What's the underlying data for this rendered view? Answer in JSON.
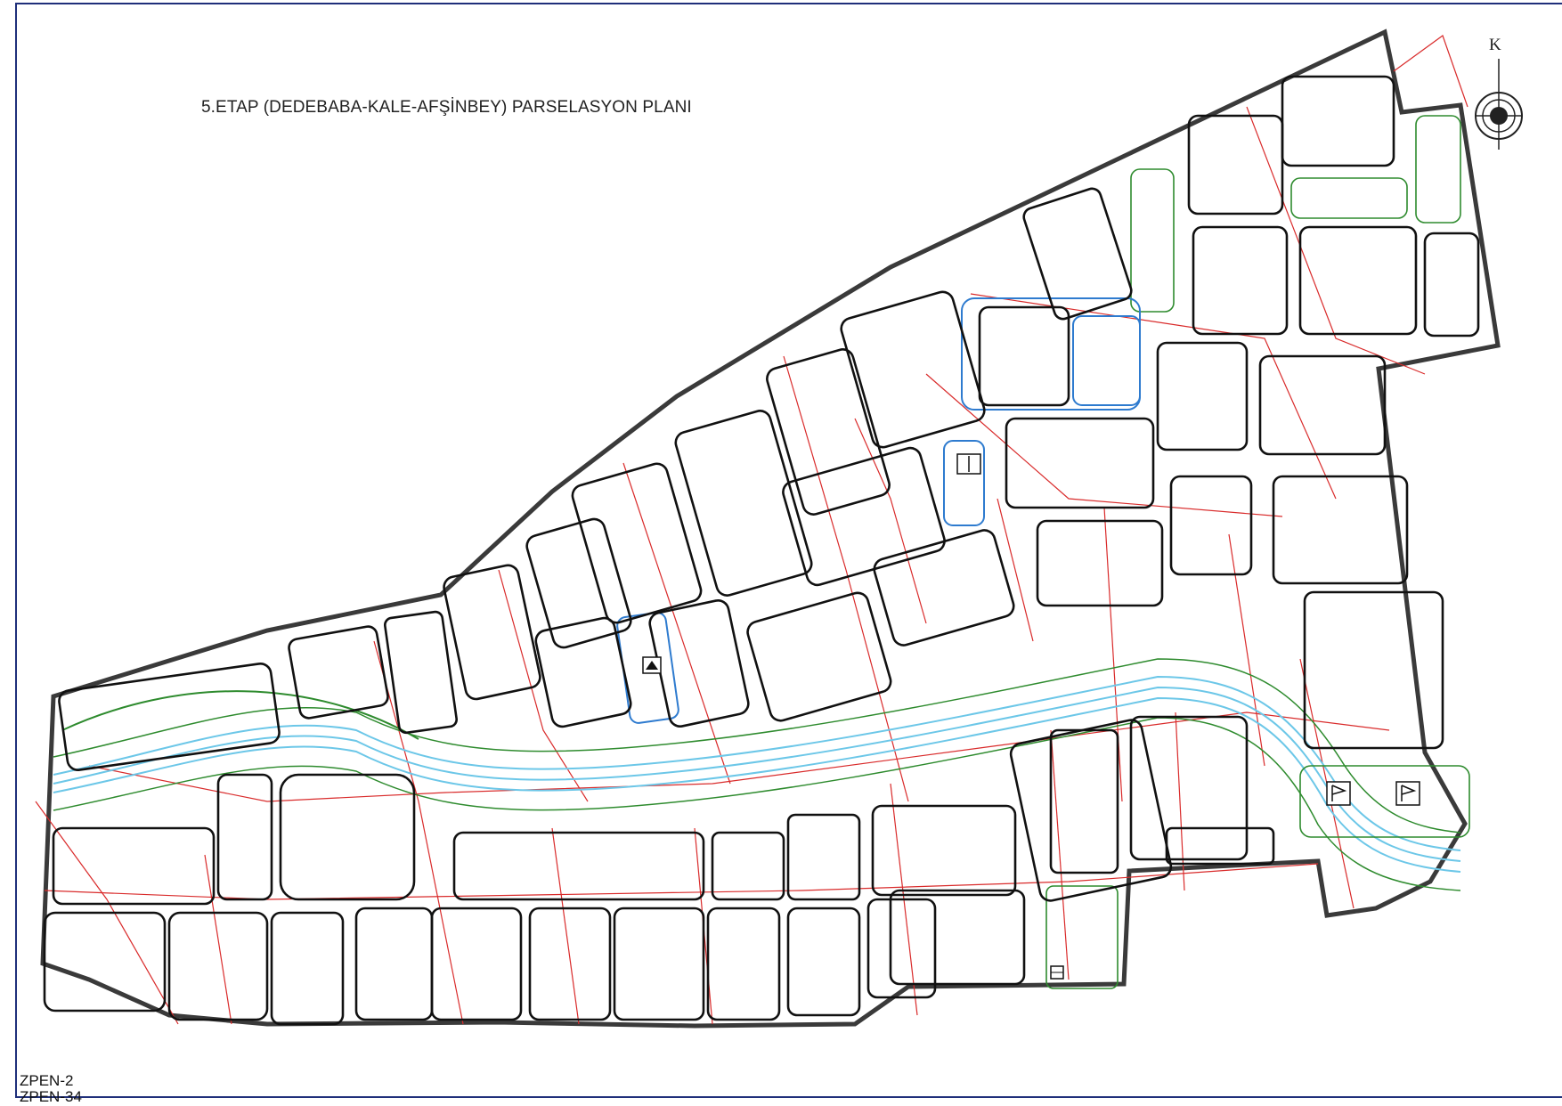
{
  "map": {
    "title": "5.ETAP (DEDEBABA-KALE-AFŞİNBEY) PARSELASYON PLANI",
    "north_label": "K",
    "sheet_tags": [
      "ZPEN-2",
      "ZPEN-34"
    ],
    "colors": {
      "frame": "#1f2f7a",
      "boundary": "#3a3a3a",
      "block": "#111111",
      "parcel": "#d92b2b",
      "green_area": "#2e8b2e",
      "waterway": "#6cc7e8",
      "special": "#2e7bcf",
      "background": "#ffffff"
    },
    "symbols": [
      "mosque-symbol",
      "school-symbol",
      "facility-symbol",
      "flag-symbol"
    ]
  }
}
